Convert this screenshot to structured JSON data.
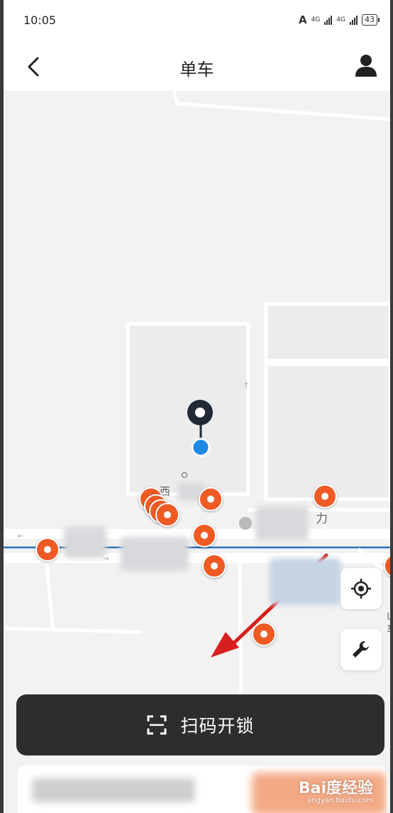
{
  "status_bar": {
    "time": "10:05",
    "net_1": "4G",
    "net_2": "4G",
    "battery": "43"
  },
  "nav": {
    "title": "单车",
    "back_icon": "chevron-left-icon",
    "profile_icon": "user-icon"
  },
  "map": {
    "labels": [
      "西",
      "力",
      "山",
      "车"
    ],
    "buttons": {
      "locate_icon": "crosshair-icon",
      "tool_icon": "wrench-icon"
    }
  },
  "scan_button": {
    "label": "扫码开锁",
    "icon": "scan-icon"
  },
  "watermark": {
    "brand": "Bai度经验",
    "url": "jingyan.baidu.com"
  },
  "colors": {
    "bike_pin": "#ee5a24",
    "user_dot": "#1e88e5",
    "scan_bg": "#2d2d2f",
    "arrow": "#d81f1f"
  }
}
